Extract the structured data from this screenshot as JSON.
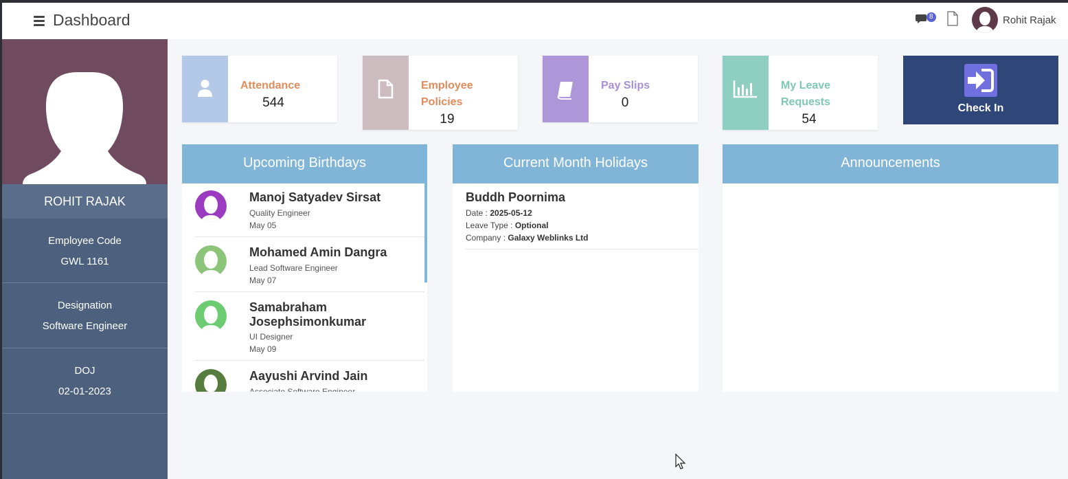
{
  "header": {
    "page_title": "Dashboard",
    "chat_badge": "8",
    "user_name": "Rohit Rajak"
  },
  "sidebar": {
    "name": "ROHIT RAJAK",
    "employee_code_label": "Employee Code",
    "employee_code": "GWL 1161",
    "designation_label": "Designation",
    "designation": "Software Engineer",
    "doj_label": "DOJ",
    "doj": "02-01-2023"
  },
  "cards": [
    {
      "label_line1": "Attendance",
      "label_line2": "",
      "value": "544",
      "color": "#e08c5b",
      "icon_bg": "#b4c8e8",
      "icon": "user-icon"
    },
    {
      "label_line1": "Employee",
      "label_line2": "Policies",
      "value": "19",
      "color": "#e08c5b",
      "icon_bg": "#cdbcbf",
      "icon": "document-icon"
    },
    {
      "label_line1": "Pay Slips",
      "label_line2": "",
      "value": "0",
      "color": "#a78fd8",
      "icon_bg": "#ae97d9",
      "icon": "book-icon"
    },
    {
      "label_line1": "My Leave",
      "label_line2": "Requests",
      "value": "54",
      "color": "#7fc8b3",
      "icon_bg": "#8ecfc2",
      "icon": "bar-chart-icon"
    }
  ],
  "checkin": {
    "label": "Check In"
  },
  "panels": {
    "birthdays_title": "Upcoming Birthdays",
    "holidays_title": "Current Month Holidays",
    "announcements_title": "Announcements"
  },
  "birthdays": [
    {
      "name": "Manoj Satyadev Sirsat",
      "role": "Quality Engineer",
      "date": "May 05",
      "color": "#9b3bbf"
    },
    {
      "name": "Mohamed Amin Dangra",
      "role": "Lead Software Engineer",
      "date": "May 07",
      "color": "#8cc57a"
    },
    {
      "name": "Samabraham Josephsimonkumar",
      "role": "UI Designer",
      "date": "May 09",
      "color": "#6dcc72"
    },
    {
      "name": "Aayushi Arvind Jain",
      "role": "Associate Software Engineer",
      "date": "",
      "color": "#567d3f"
    }
  ],
  "holiday": {
    "name": "Buddh Poornima",
    "date_label": "Date : ",
    "date": "2025-05-12",
    "leave_type_label": "Leave Type : ",
    "leave_type": "Optional",
    "company_label": "Company : ",
    "company": "Galaxy Weblinks Ltd"
  }
}
